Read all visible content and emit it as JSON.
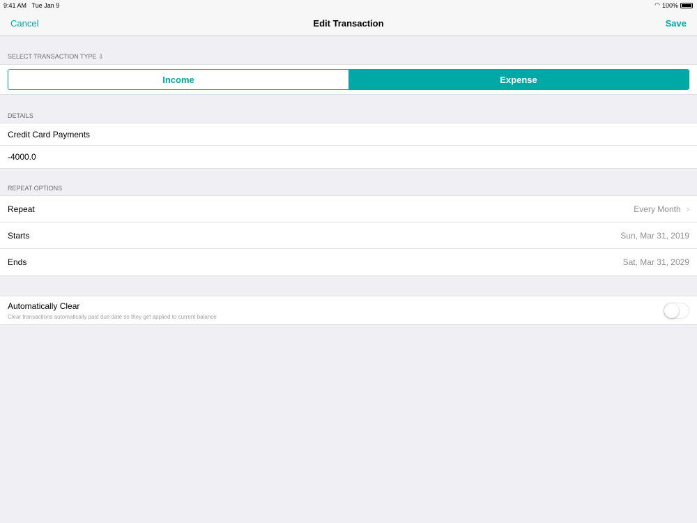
{
  "status": {
    "time": "9:41 AM",
    "date": "Tue Jan 9",
    "battery": "100%"
  },
  "nav": {
    "cancel": "Cancel",
    "title": "Edit Transaction",
    "save": "Save"
  },
  "type": {
    "header": "SELECT TRANSACTION TYPE ⇩",
    "income": "Income",
    "expense": "Expense",
    "selected": "Expense"
  },
  "details": {
    "header": "DETAILS",
    "name": "Credit Card Payments",
    "amount": "-4000.0"
  },
  "repeat": {
    "header": "REPEAT OPTIONS",
    "rows": [
      {
        "label": "Repeat",
        "value": "Every Month"
      },
      {
        "label": "Starts",
        "value": "Sun, Mar 31, 2019"
      },
      {
        "label": "Ends",
        "value": "Sat, Mar 31, 2029"
      }
    ]
  },
  "auto_clear": {
    "label": "Automatically Clear",
    "description": "Clear transactions automatically past due date so they get applied to current balance",
    "enabled": false
  },
  "colors": {
    "accent": "#00a9a5"
  }
}
